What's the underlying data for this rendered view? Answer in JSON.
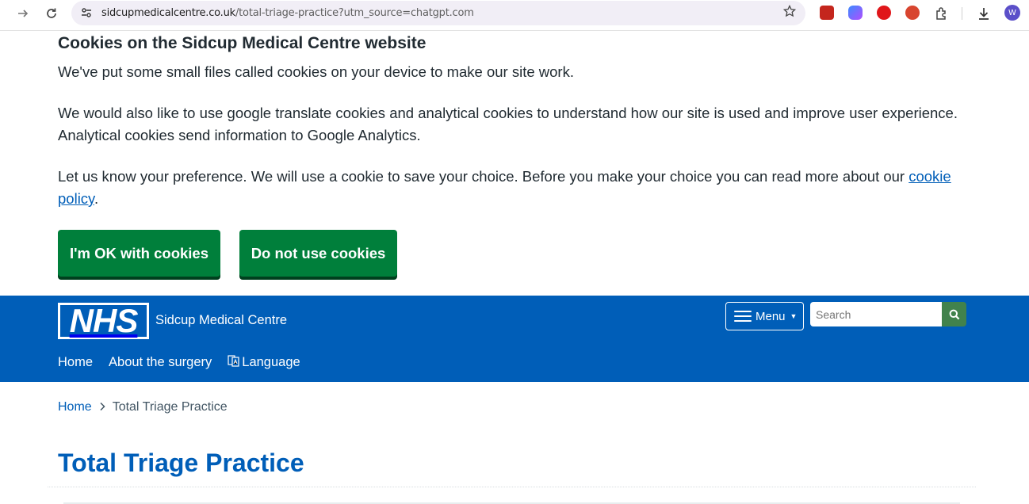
{
  "browser": {
    "url_host": "sidcupmedicalcentre.co.uk",
    "url_path": "/total-triage-practice?utm_source=chatgpt.com",
    "forward_icon": "arrow-forward-icon",
    "reload_icon": "reload-icon",
    "bookmark_icon": "star-icon",
    "profile_initial": "W"
  },
  "cookie_banner": {
    "title": "Cookies on the Sidcup Medical Centre website",
    "para1": "We've put some small files called cookies on your device to make our site work.",
    "para2": "We would also like to use google translate cookies and analytical cookies to understand how our site is used and improve user experience. Analytical cookies send information to Google Analytics.",
    "para3_text": "Let us know your preference. We will use a cookie to save your choice. Before you make your choice you can read more about our ",
    "para3_link": "cookie policy",
    "para3_end": ".",
    "accept_label": "I'm OK with cookies",
    "reject_label": "Do not use cookies"
  },
  "header": {
    "logo_text": "NHS",
    "org_name": "Sidcup Medical Centre",
    "menu_label": "Menu",
    "search_placeholder": "Search",
    "nav": [
      "Home",
      "About the surgery",
      "Language"
    ]
  },
  "breadcrumb": {
    "home": "Home",
    "current": "Total Triage Practice"
  },
  "page": {
    "title": "Total Triage Practice"
  },
  "colors": {
    "nhs_blue": "#005eb8",
    "button_green": "#007f3b",
    "search_green": "#41824c"
  }
}
